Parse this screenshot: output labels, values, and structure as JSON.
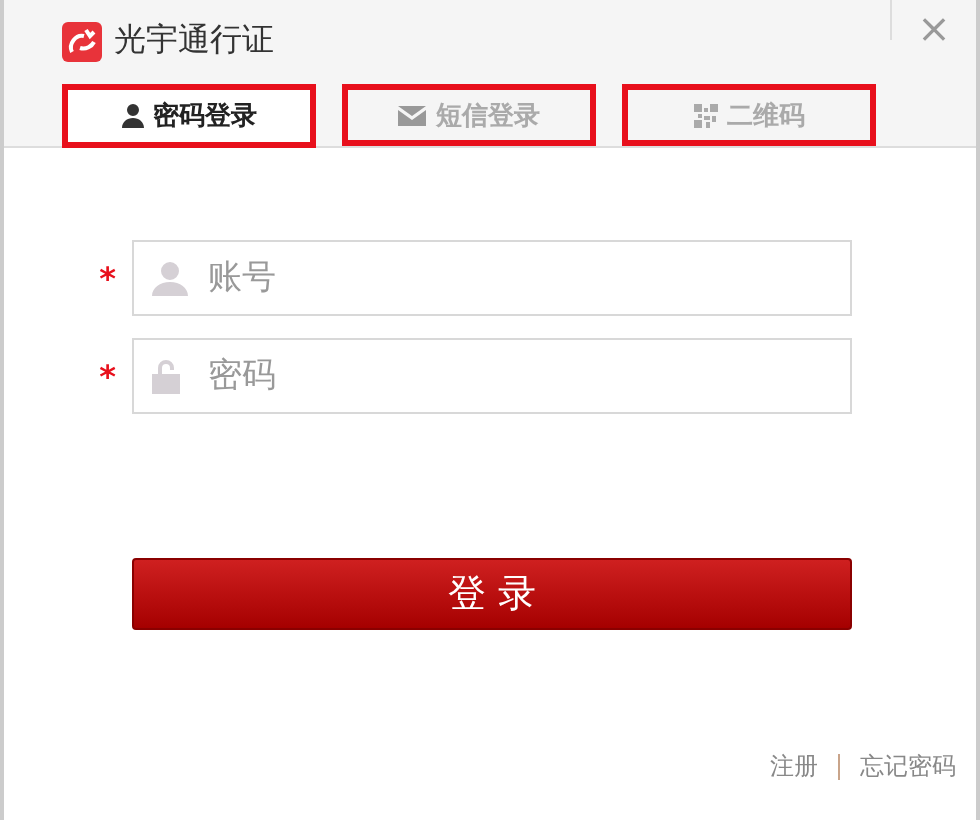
{
  "window": {
    "title": "光宇通行证",
    "close": "×"
  },
  "tabs": [
    {
      "label": "密码登录",
      "kind": "password",
      "selected": true
    },
    {
      "label": "短信登录",
      "kind": "sms",
      "selected": false
    },
    {
      "label": "二维码",
      "kind": "qr",
      "selected": false
    }
  ],
  "fields": [
    {
      "kind": "user",
      "placeholder": "账号",
      "required": "*"
    },
    {
      "kind": "lock",
      "placeholder": "密码",
      "required": "*"
    }
  ],
  "login_button": "登 录",
  "footer_links": [
    "注册",
    "忘记密码"
  ]
}
